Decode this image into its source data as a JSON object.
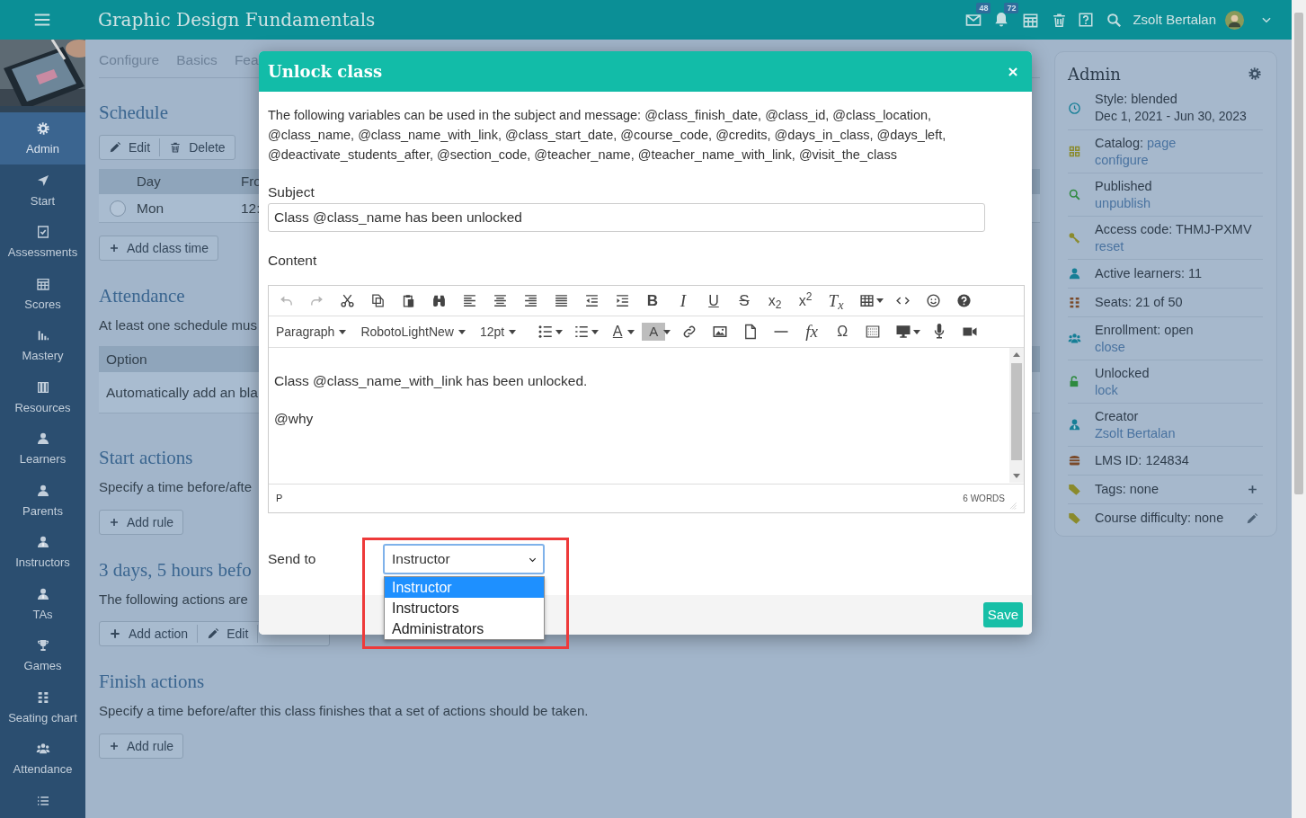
{
  "app_bar": {
    "title": "Graphic Design Fundamentals",
    "badges": [
      "48",
      "72"
    ],
    "user_name": "Zsolt Bertalan"
  },
  "sidebar": {
    "items": [
      {
        "label": "Admin",
        "selected": true
      },
      {
        "label": "Start",
        "selected": false
      },
      {
        "label": "Assessments",
        "selected": false
      },
      {
        "label": "Scores",
        "selected": false
      },
      {
        "label": "Mastery",
        "selected": false
      },
      {
        "label": "Resources",
        "selected": false
      },
      {
        "label": "Learners",
        "selected": false
      },
      {
        "label": "Parents",
        "selected": false
      },
      {
        "label": "Instructors",
        "selected": false
      },
      {
        "label": "TAs",
        "selected": false
      },
      {
        "label": "Games",
        "selected": false
      },
      {
        "label": "Seating chart",
        "selected": false
      },
      {
        "label": "Attendance",
        "selected": false
      },
      {
        "selected": false
      }
    ]
  },
  "tabs": [
    {
      "label": "Configure",
      "selected": false
    },
    {
      "label": "Basics",
      "selected": false
    },
    {
      "label": "Fea",
      "selected": false
    }
  ],
  "schedule": {
    "title": "Schedule",
    "buttons": [
      "Edit",
      "Delete"
    ],
    "columns": [
      "Day",
      "Fro"
    ],
    "rows": [
      {
        "selected": false,
        "cells": [
          "Mon",
          "12:"
        ]
      }
    ],
    "add_button": "Add class time"
  },
  "attendance": {
    "title": "Attendance",
    "text": "At least one schedule mus",
    "columns": [
      "Option"
    ],
    "rows": [
      [
        "Automatically add an bla"
      ]
    ]
  },
  "start_actions": {
    "title": "Start actions",
    "text": "Specify a time before/afte",
    "add_button": "Add rule"
  },
  "action_rule": {
    "title": "3 days, 5 hours befo",
    "text": "The following actions are",
    "buttons": [
      "Add action",
      "Edit"
    ]
  },
  "finish_actions": {
    "title": "Finish actions",
    "text": "Specify a time before/after this class finishes that a set of actions should be taken.",
    "add_button": "Add rule"
  },
  "admin_panel": {
    "title": "Admin",
    "items": [
      {
        "text": "Style: blended",
        "detail": "Dec 1, 2021 - Jun 30, 2023"
      },
      {
        "text": "Catalog:",
        "inline_link": "page",
        "link": "configure"
      },
      {
        "text": "Published",
        "link": "unpublish"
      },
      {
        "text": "Access code: THMJ-PXMV",
        "link": "reset"
      },
      {
        "text": "Active learners: 11"
      },
      {
        "text": "Seats: 21 of 50"
      },
      {
        "text": "Enrollment: open",
        "link": "close"
      },
      {
        "text": "Unlocked",
        "link": "lock"
      },
      {
        "text": "Creator",
        "link": "Zsolt Bertalan"
      },
      {
        "text": "LMS ID: 124834"
      },
      {
        "text": "Tags: none"
      },
      {
        "text": "Course difficulty: none"
      }
    ]
  },
  "dialog": {
    "title": "Unlock class",
    "intro": "The following variables can be used in the subject and message: @class_finish_date, @class_id, @class_location, @class_name, @class_name_with_link, @class_start_date, @course_code, @credits, @days_in_class, @days_left, @deactivate_students_after, @section_code, @teacher_name, @teacher_name_with_link, @visit_the_class",
    "subject_label": "Subject",
    "subject_value": "Class @class_name has been unlocked",
    "content_label": "Content",
    "editor": {
      "toolbar": [
        [
          {
            "kind": "icon",
            "disabled": true
          },
          {
            "kind": "icon",
            "disabled": true
          },
          {
            "kind": "icon",
            "disabled": false
          },
          {
            "kind": "icon",
            "disabled": false
          },
          {
            "kind": "icon",
            "disabled": false
          },
          {
            "kind": "icon",
            "disabled": false
          },
          {
            "kind": "icon",
            "disabled": false
          },
          {
            "kind": "icon",
            "disabled": false
          },
          {
            "kind": "icon",
            "disabled": false
          },
          {
            "kind": "icon",
            "disabled": false
          },
          {
            "kind": "icon",
            "disabled": false
          },
          {
            "kind": "icon",
            "disabled": false
          },
          {
            "kind": "glyph",
            "text": "B",
            "disabled": false
          },
          {
            "kind": "glyph",
            "text": "I",
            "disabled": false
          },
          {
            "kind": "glyph",
            "text": "U",
            "disabled": false
          },
          {
            "kind": "glyph",
            "text": "S",
            "disabled": false
          },
          {
            "kind": "glyph",
            "text": "x$_{2}$",
            "disabled": false
          },
          {
            "kind": "glyph",
            "text": "x$^{2}$",
            "disabled": false
          },
          {
            "kind": "glyph",
            "text": "T$_{x}$",
            "disabled": false
          },
          {
            "kind": "icon",
            "disabled": false
          },
          {
            "kind": "caret",
            "disabled": false
          },
          {
            "kind": "icon",
            "disabled": false
          },
          {
            "kind": "icon",
            "disabled": false
          },
          {
            "kind": "icon",
            "disabled": false
          }
        ],
        [
          {
            "kind": "dropdown",
            "text": "Paragraph",
            "disabled": false
          },
          {
            "kind": "dropdown",
            "text": "RobotoLightNew",
            "disabled": false
          },
          {
            "kind": "dropdown",
            "text": "12pt",
            "disabled": false
          },
          {
            "kind": "icon",
            "disabled": false
          },
          {
            "kind": "caret",
            "disabled": false
          },
          {
            "kind": "icon",
            "disabled": false
          },
          {
            "kind": "caret",
            "disabled": false
          },
          {
            "kind": "glyph",
            "text": "A",
            "disabled": false
          },
          {
            "kind": "caret",
            "disabled": false
          },
          {
            "kind": "glyph",
            "text": "A",
            "disabled": false
          },
          {
            "kind": "caret",
            "disabled": false
          },
          {
            "kind": "icon",
            "disabled": false
          },
          {
            "kind": "icon",
            "disabled": false
          },
          {
            "kind": "icon",
            "disabled": false
          },
          {
            "kind": "icon",
            "disabled": false
          },
          {
            "kind": "glyph",
            "text": "fx",
            "disabled": false
          },
          {
            "kind": "glyph",
            "text": "Ω",
            "disabled": false
          },
          {
            "kind": "icon",
            "disabled": false
          },
          {
            "kind": "icon",
            "disabled": false
          },
          {
            "kind": "caret",
            "disabled": false
          },
          {
            "kind": "icon",
            "disabled": false
          },
          {
            "kind": "icon",
            "disabled": false
          }
        ]
      ],
      "body": [
        "Class @class_name_with_link has been unlocked.",
        "@why"
      ],
      "path": "P",
      "word_count": "6 WORDS"
    },
    "send_to": {
      "label": "Send to",
      "value": "Instructor",
      "expanded": true,
      "options": [
        {
          "label": "Instructor",
          "selected": true
        },
        {
          "label": "Instructors",
          "selected": false
        },
        {
          "label": "Administrators",
          "selected": false
        }
      ]
    },
    "save_button": "Save"
  }
}
